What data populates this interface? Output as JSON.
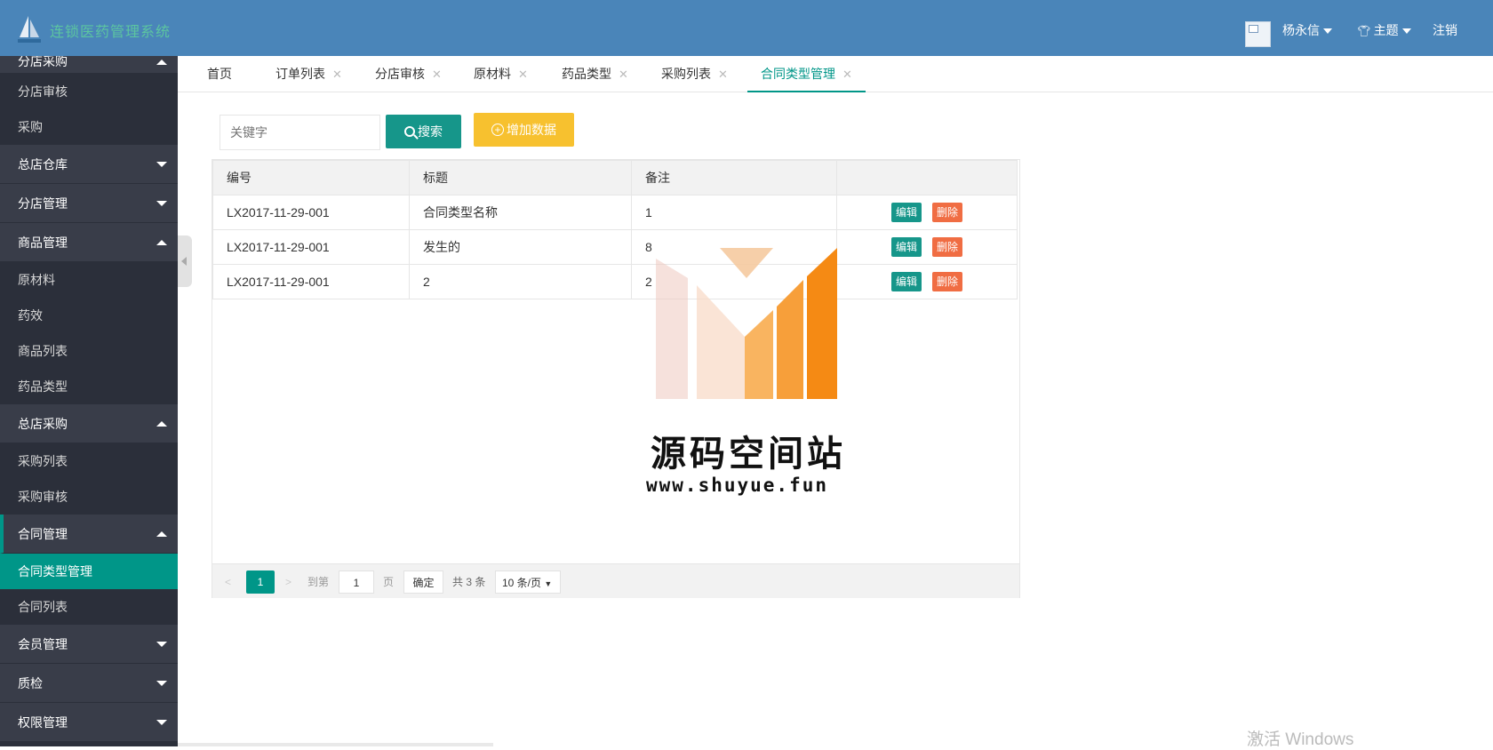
{
  "header": {
    "app_title": "连锁医药管理系统",
    "user_name": "杨永信",
    "theme_label": "主题",
    "logout_label": "注销"
  },
  "sidebar": {
    "groups": [
      {
        "label": "分店采购",
        "expanded": true,
        "items": [
          "分店审核",
          "采购"
        ]
      },
      {
        "label": "总店仓库",
        "expanded": false,
        "items": []
      },
      {
        "label": "分店管理",
        "expanded": false,
        "items": []
      },
      {
        "label": "商品管理",
        "expanded": true,
        "items": [
          "原材料",
          "药效",
          "商品列表",
          "药品类型"
        ]
      },
      {
        "label": "总店采购",
        "expanded": true,
        "items": [
          "采购列表",
          "采购审核"
        ]
      },
      {
        "label": "合同管理",
        "expanded": true,
        "items": [
          "合同类型管理",
          "合同列表"
        ]
      },
      {
        "label": "会员管理",
        "expanded": false,
        "items": []
      },
      {
        "label": "质检",
        "expanded": false,
        "items": []
      },
      {
        "label": "权限管理",
        "expanded": false,
        "items": []
      }
    ],
    "active_item": "合同类型管理"
  },
  "tabs": [
    {
      "label": "首页",
      "closable": false
    },
    {
      "label": "订单列表",
      "closable": true
    },
    {
      "label": "分店审核",
      "closable": true
    },
    {
      "label": "原材料",
      "closable": true
    },
    {
      "label": "药品类型",
      "closable": true
    },
    {
      "label": "采购列表",
      "closable": true
    },
    {
      "label": "合同类型管理",
      "closable": true,
      "active": true
    }
  ],
  "toolbar": {
    "search_placeholder": "关键字",
    "search_label": "搜索",
    "add_label": "增加数据"
  },
  "table": {
    "columns": [
      "编号",
      "标题",
      "备注",
      ""
    ],
    "rows": [
      {
        "id": "LX2017-11-29-001",
        "title": "合同类型名称",
        "remark": "1"
      },
      {
        "id": "LX2017-11-29-001",
        "title": "发生的",
        "remark": "8"
      },
      {
        "id": "LX2017-11-29-001",
        "title": "2",
        "remark": "2"
      }
    ],
    "edit_label": "编辑",
    "delete_label": "删除"
  },
  "pager": {
    "current_page": "1",
    "goto_label": "到第",
    "goto_value": "1",
    "page_unit": "页",
    "confirm_label": "确定",
    "total_label": "共 3 条",
    "page_size": "10 条/页"
  },
  "watermark": {
    "title": "源码空间站",
    "url": "www.shuyue.fun"
  },
  "os_notice": "激活 Windows",
  "colors": {
    "header": "#4a85b9",
    "sidebar": "#2b2f3a",
    "accent": "#009688",
    "add_button": "#f7c12f",
    "delete_button": "#f06d43"
  }
}
